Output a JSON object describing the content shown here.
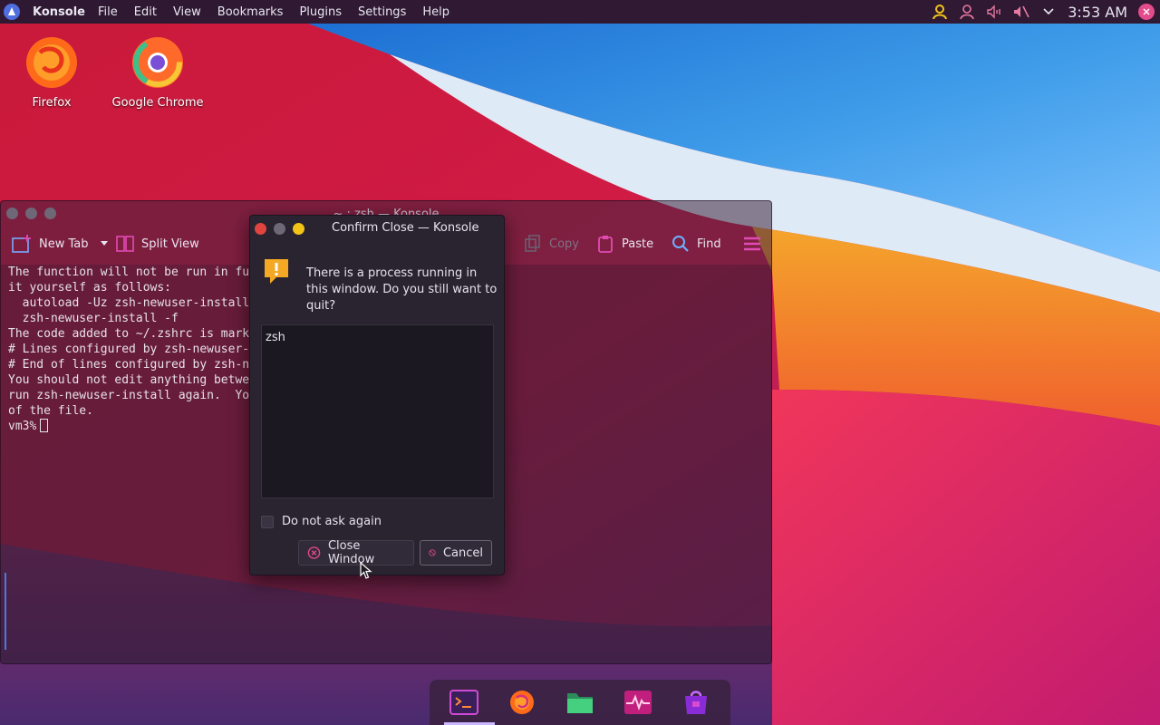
{
  "top_panel": {
    "app_name": "Konsole",
    "menu": [
      "File",
      "Edit",
      "View",
      "Bookmarks",
      "Plugins",
      "Settings",
      "Help"
    ],
    "clock": "3:53 AM",
    "tray_icons": [
      "user-status-icon",
      "user-icon",
      "volume-icon",
      "muted-speaker-icon",
      "chevron-down-icon"
    ]
  },
  "desktop_icons": [
    {
      "label": "Firefox",
      "icon": "firefox-icon"
    },
    {
      "label": "Google Chrome",
      "icon": "chrome-icon"
    }
  ],
  "konsole": {
    "title": "~ : zsh — Konsole",
    "toolbar": {
      "new_tab": "New Tab",
      "split_view": "Split View",
      "copy": "Copy",
      "paste": "Paste",
      "find": "Find"
    },
    "terminal_lines": [
      "The function will not be run in fu",
      "it yourself as follows:",
      "  autoload -Uz zsh-newuser-install",
      "  zsh-newuser-install -f",
      "",
      "The code added to ~/.zshrc is mark",
      "# Lines configured by zsh-newuser-",
      "# End of lines configured by zsh-n",
      "You should not edit anything betwe",
      "run zsh-newuser-install again.  Yo",
      "of the file."
    ],
    "prompt": "vm3%"
  },
  "dialog": {
    "title": "Confirm Close — Konsole",
    "message": "There is a process running in this window. Do you still want to quit?",
    "processes": [
      "zsh"
    ],
    "dont_ask_label": "Do not ask again",
    "close_window_label": "Close Window",
    "cancel_label": "Cancel"
  },
  "dock": {
    "items": [
      "konsole-icon",
      "firefox-icon",
      "files-icon",
      "system-monitor-icon",
      "store-icon"
    ]
  },
  "colors": {
    "accent": "#e04ab0",
    "dialog_bg": "#2a2431",
    "close_red": "#e0443e",
    "minimize_grey": "#6e6776",
    "maximize_yellow": "#f2c416"
  }
}
